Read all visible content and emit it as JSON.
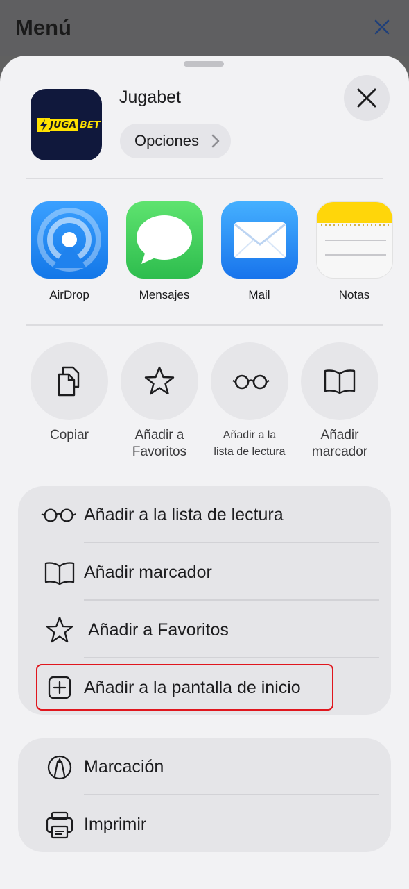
{
  "background": {
    "title": "Menú",
    "close_icon": "close-icon"
  },
  "share_header": {
    "app_logo_part1": "JUGA",
    "app_logo_part2": "BET",
    "app_name": "Jugabet",
    "options_label": "Opciones"
  },
  "share_apps": [
    {
      "label": "AirDrop",
      "icon": "airdrop-icon",
      "color": "#1b8cf2"
    },
    {
      "label": "Mensajes",
      "icon": "messages-icon",
      "color": "#32c759"
    },
    {
      "label": "Mail",
      "icon": "mail-icon",
      "color": "#1e8bf3"
    },
    {
      "label": "Notas",
      "icon": "notes-icon",
      "color": "#ffd60a"
    }
  ],
  "quick_actions": [
    {
      "label_line1": "Copiar",
      "label_line2": "",
      "icon": "copy-icon"
    },
    {
      "label_line1": "Añadir a",
      "label_line2": "Favoritos",
      "icon": "star-icon"
    },
    {
      "label_line1": "Añadir a la",
      "label_line2": "lista de lectura",
      "icon": "glasses-icon"
    },
    {
      "label_line1": "Añadir",
      "label_line2": "marcador",
      "icon": "book-icon"
    }
  ],
  "list_group1": [
    {
      "label": "Añadir a la lista de lectura",
      "icon": "glasses-icon"
    },
    {
      "label": "Añadir marcador",
      "icon": "book-icon"
    },
    {
      "label": "Añadir a Favoritos",
      "icon": "star-icon"
    },
    {
      "label": "Añadir a la pantalla de inicio",
      "icon": "add-square-icon",
      "highlighted": true
    }
  ],
  "list_group2": [
    {
      "label": "Marcación",
      "icon": "markup-icon"
    },
    {
      "label": "Imprimir",
      "icon": "printer-icon"
    }
  ],
  "colors": {
    "highlight": "#e0161d",
    "sheet_bg": "#f2f2f4",
    "group_bg": "#e5e5e8"
  }
}
